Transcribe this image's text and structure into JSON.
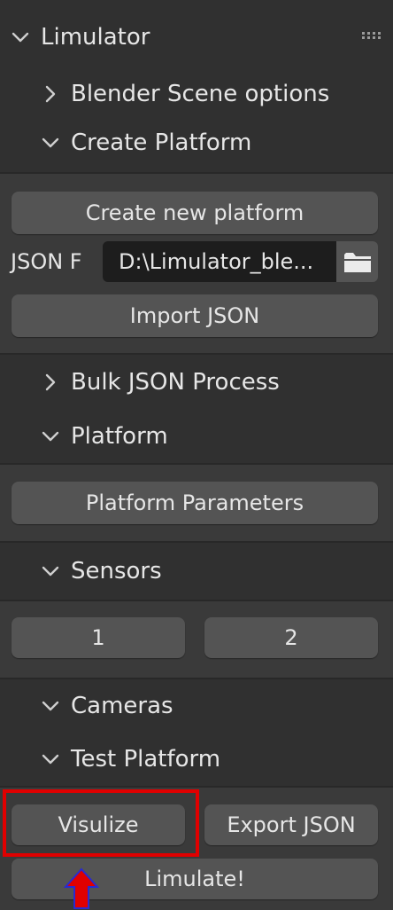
{
  "panel": {
    "title": "Limulator",
    "sections": {
      "blender_scene": "Blender Scene options",
      "create_platform": "Create Platform",
      "bulk_json": "Bulk JSON Process",
      "platform": "Platform",
      "sensors": "Sensors",
      "cameras": "Cameras",
      "test_platform": "Test Platform"
    },
    "create_platform": {
      "new_button": "Create new platform",
      "json_label": "JSON F",
      "json_path": "D:\\Limulator_ble...",
      "import_button": "Import JSON"
    },
    "platform": {
      "params_button": "Platform Parameters"
    },
    "sensors": {
      "buttons": [
        "1",
        "2"
      ]
    },
    "test_platform": {
      "visualize_button": "Visulize",
      "export_button": "Export JSON",
      "limulate_button": "Limulate!"
    }
  },
  "annotation": {
    "highlight_color": "#e00000",
    "arrow_fill": "#e00000",
    "arrow_outline": "#2a2ad0"
  }
}
